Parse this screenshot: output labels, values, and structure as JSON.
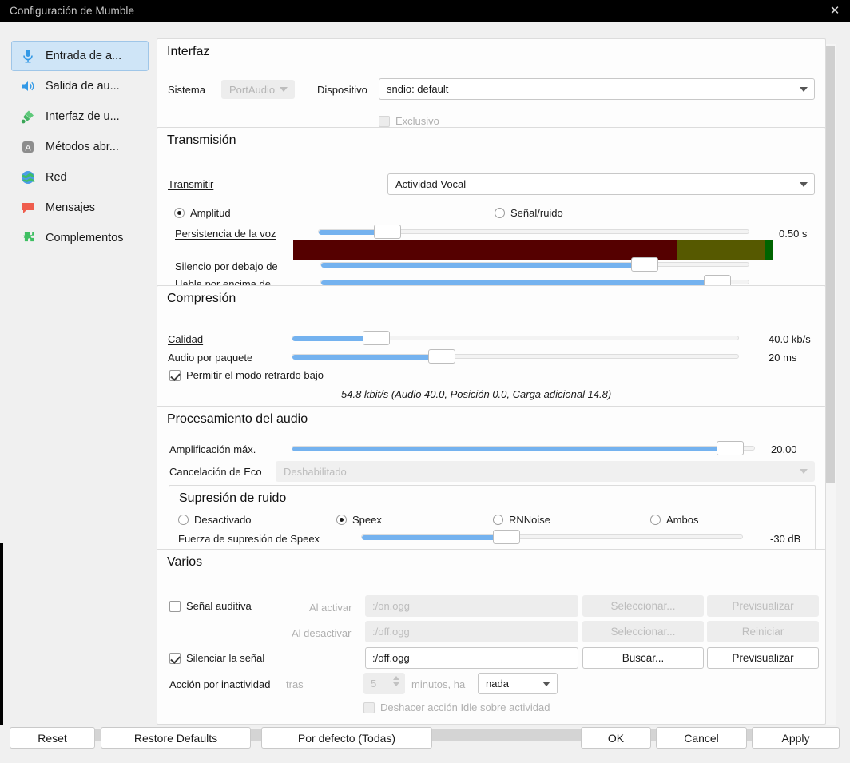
{
  "window": {
    "title": "Configuración de Mumble",
    "close_label": "✕"
  },
  "sidebar": {
    "items": [
      {
        "label": "Entrada de a...",
        "icon": "microphone-icon"
      },
      {
        "label": "Salida de au...",
        "icon": "speaker-icon"
      },
      {
        "label": "Interfaz de u...",
        "icon": "paintbrush-icon"
      },
      {
        "label": "Métodos abr...",
        "icon": "keyboard-shortcut-icon"
      },
      {
        "label": "Red",
        "icon": "globe-icon"
      },
      {
        "label": "Mensajes",
        "icon": "chat-bubble-icon"
      },
      {
        "label": "Complementos",
        "icon": "puzzle-piece-icon"
      }
    ]
  },
  "interfaz": {
    "title": "Interfaz",
    "sistema_label": "Sistema",
    "sistema_value": "PortAudio",
    "dispositivo_label": "Dispositivo",
    "dispositivo_value": "sndio: default",
    "exclusivo_label": "Exclusivo"
  },
  "transmision": {
    "title": "Transmisión",
    "transmitir_label": "Transmitir",
    "transmitir_value": "Actividad Vocal",
    "amplitud_label": "Amplitud",
    "senal_ruido_label": "Señal/ruido",
    "persistencia_label": "Persistencia de la voz",
    "persistencia_value": "0.50 s",
    "silencio_label": "Silencio por debajo de",
    "habla_label": "Habla por encima de"
  },
  "compresion": {
    "title": "Compresión",
    "calidad_label": "Calidad",
    "calidad_value": "40.0 kb/s",
    "audio_paquete_label": "Audio por paquete",
    "audio_paquete_value": "20 ms",
    "retardo_label": "Permitir el modo retrardo bajo",
    "bitrate_note": "54.8 kbit/s (Audio 40.0, Posición 0.0, Carga adicional 14.8)"
  },
  "procesamiento": {
    "title": "Procesamiento del audio",
    "amplificacion_label": "Amplificación máx.",
    "amplificacion_value": "20.00",
    "eco_label": "Cancelación de Eco",
    "eco_value": "Deshabilitado",
    "supresion": {
      "title": "Supresión de ruido",
      "options": [
        "Desactivado",
        "Speex",
        "RNNoise",
        "Ambos"
      ],
      "fuerza_label": "Fuerza de supresión de Speex",
      "fuerza_value": "-30 dB"
    }
  },
  "varios": {
    "title": "Varios",
    "senal_auditiva_label": "Señal auditiva",
    "al_activar_label": "Al activar",
    "al_activar_value": ":/on.ogg",
    "seleccionar_1": "Seleccionar...",
    "previsualizar_1": "Previsualizar",
    "al_desactivar_label": "Al desactivar",
    "al_desactivar_value": ":/off.ogg",
    "seleccionar_2": "Seleccionar...",
    "reiniciar": "Reiniciar",
    "silenciar_label": "Silenciar la señal",
    "silenciar_value": ":/off.ogg",
    "buscar": "Buscar...",
    "previsualizar_2": "Previsualizar",
    "inactividad_label": "Acción por inactividad",
    "tras_label": "tras",
    "minutos_value": "5",
    "minutos_label": "minutos, ha",
    "accion_value": "nada",
    "deshacer_label": "Deshacer acción Idle sobre actividad"
  },
  "footer": {
    "reset": "Reset",
    "restore_defaults": "Restore Defaults",
    "por_defecto": "Por defecto (Todas)",
    "ok": "OK",
    "cancel": "Cancel",
    "apply": "Apply"
  },
  "colors": {
    "accent_slider": "#74b2ef",
    "select_bg": "#cfe5f7",
    "vu_red": "#550000",
    "vu_olive": "#565900",
    "vu_green": "#006400"
  }
}
